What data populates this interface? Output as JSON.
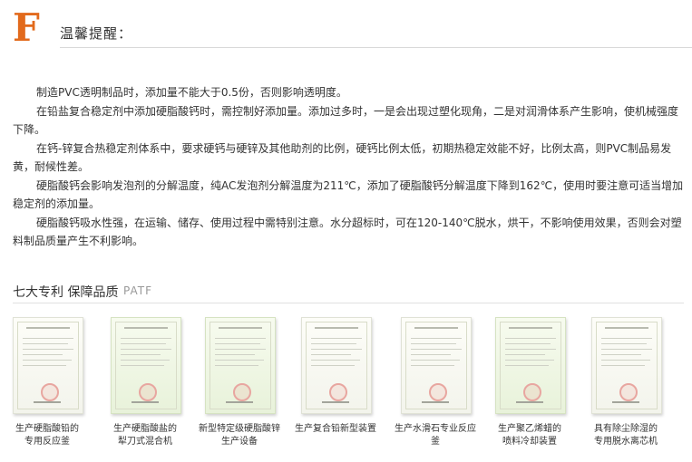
{
  "header": {
    "logo_letter": "F",
    "title": "温馨提醒："
  },
  "tips": [
    "制造PVC透明制品时，添加量不能大于0.5份，否则影响透明度。",
    "在铅盐复合稳定剂中添加硬脂酸钙时，需控制好添加量。添加过多时，一是会出现过塑化现角，二是对润滑体系产生影响，使机械强度下降。",
    "在钙-锌复合热稳定剂体系中，要求硬钙与硬锌及其他助剂的比例，硬钙比例太低，初期热稳定效能不好，比例太高，则PVC制品易发黄，耐候性差。",
    "硬脂酸钙会影响发泡剂的分解温度，纯AC发泡剂分解温度为211℃，添加了硬脂酸钙分解温度下降到162℃，使用时要注意可适当增加稳定剂的添加量。",
    "硬脂酸钙吸水性强，在运输、储存、使用过程中需特别注意。水分超标时，可在120-140℃脱水，烘干，不影响使用效果，否则会对塑料制品质量产生不利影响。"
  ],
  "patents": {
    "title": "七大专利 保障品质",
    "subtitle": "PATF",
    "items": [
      {
        "line1": "生产硬脂酸铅的",
        "line2": "专用反应釜"
      },
      {
        "line1": "生产硬脂酸盐的",
        "line2": "犁刀式混合机"
      },
      {
        "line1": "新型特定级硬脂酸锌",
        "line2": "生产设备"
      },
      {
        "line1": "生产复合铅新型装置",
        "line2": ""
      },
      {
        "line1": "生产水滑石专业反应釜",
        "line2": ""
      },
      {
        "line1": "生产聚乙烯蜡的",
        "line2": "喷料冷却装置"
      },
      {
        "line1": "具有除尘除湿的",
        "line2": "专用脱水离芯机"
      }
    ]
  }
}
